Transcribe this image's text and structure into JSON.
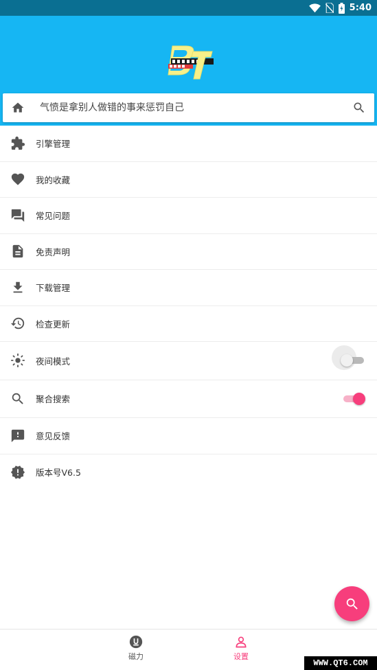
{
  "status_bar": {
    "time": "5:40"
  },
  "colors": {
    "header_bg": "#16b6f3",
    "status_bg": "#0a6f92",
    "accent": "#f73e7c",
    "icon": "#555555"
  },
  "search": {
    "hint": "气愤是拿别人做错的事来惩罚自己",
    "left_icon": "home-icon",
    "right_icon": "search-icon"
  },
  "menu": [
    {
      "label": "引擎管理",
      "icon": "puzzle-icon"
    },
    {
      "label": "我的收藏",
      "icon": "heart-icon"
    },
    {
      "label": "常见问题",
      "icon": "forum-icon"
    },
    {
      "label": "免责声明",
      "icon": "document-icon"
    },
    {
      "label": "下载管理",
      "icon": "download-icon"
    },
    {
      "label": "检查更新",
      "icon": "history-icon"
    },
    {
      "label": "夜间模式",
      "icon": "brightness-icon",
      "toggle": false
    },
    {
      "label": "聚合搜索",
      "icon": "search-icon",
      "toggle": true
    },
    {
      "label": "意见反馈",
      "icon": "feedback-icon"
    },
    {
      "label": "版本号V6.5",
      "icon": "alert-badge-icon"
    }
  ],
  "bottom_nav": [
    {
      "label": "磁力",
      "icon": "magnet-icon",
      "active": false
    },
    {
      "label": "设置",
      "icon": "person-icon",
      "active": true
    }
  ],
  "watermark": "WWW.QT6.COM"
}
